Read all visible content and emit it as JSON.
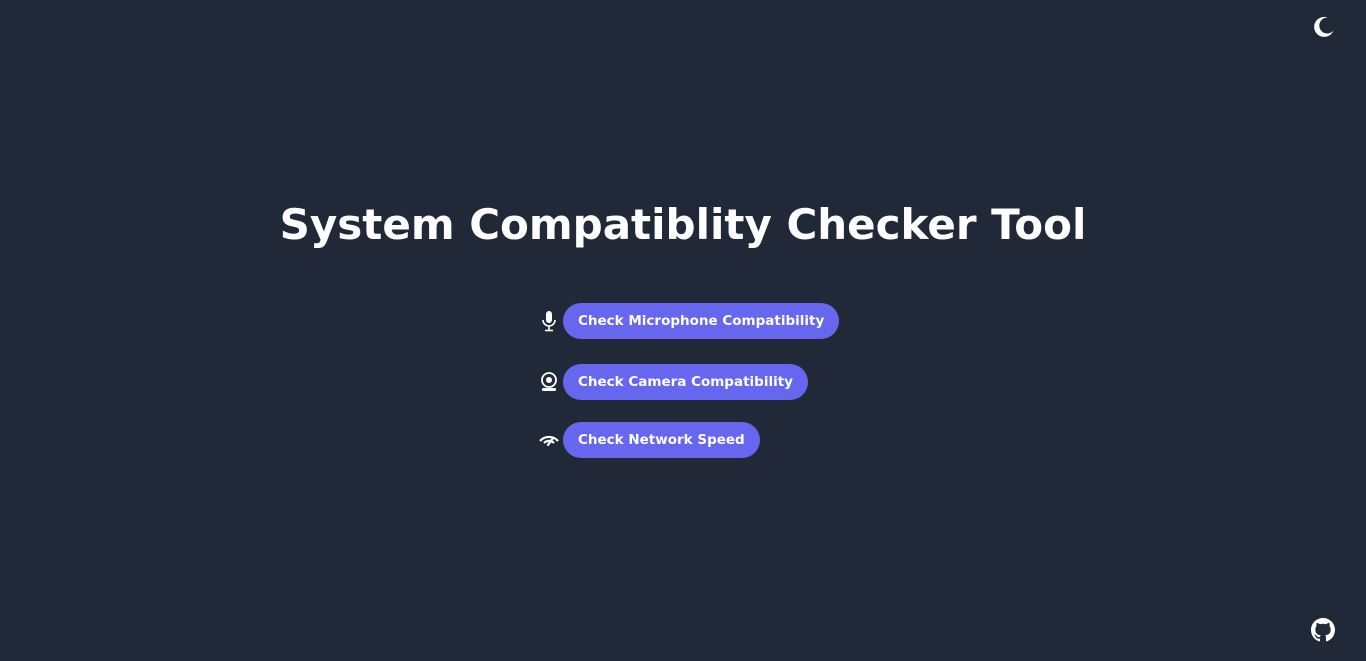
{
  "header": {
    "theme_toggle_icon": "moon-icon"
  },
  "main": {
    "title": "System Compatiblity Checker Tool",
    "checks": [
      {
        "icon": "microphone-icon",
        "label": "Check Microphone Compatibility"
      },
      {
        "icon": "webcam-icon",
        "label": "Check Camera Compatibility"
      },
      {
        "icon": "network-speed-icon",
        "label": "Check Network Speed"
      }
    ]
  },
  "footer": {
    "github_icon": "github-icon"
  },
  "colors": {
    "background": "#212938",
    "button": "#6667ee",
    "text": "#ffffff"
  }
}
